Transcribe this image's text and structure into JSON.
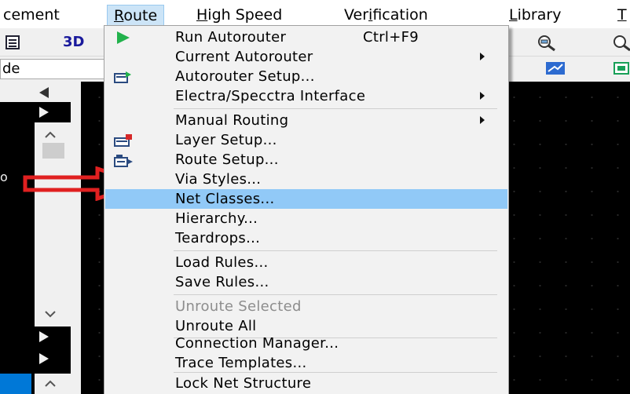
{
  "menubar": {
    "items": [
      {
        "label": "cement",
        "mnemonic": ""
      },
      {
        "label": "Route",
        "mnemonic": "R"
      },
      {
        "label": "High Speed",
        "mnemonic": "H"
      },
      {
        "label": "Verification",
        "mnemonic": "i"
      },
      {
        "label": "Library",
        "mnemonic": "L"
      },
      {
        "label": "T",
        "mnemonic": "T"
      }
    ]
  },
  "toolbar": {
    "view_3d_label": "3D",
    "mode_dropdown_value": "de"
  },
  "route_menu": {
    "items": [
      {
        "label": "Run Autorouter",
        "shortcut": "Ctrl+F9",
        "icon": "play-icon"
      },
      {
        "label": "Current Autorouter",
        "submenu": true
      },
      {
        "label": "Autorouter Setup...",
        "icon": "autorouter-setup-icon"
      },
      {
        "label": "Electra/Specctra Interface",
        "submenu": true
      },
      {
        "label": "Manual Routing",
        "submenu": true
      },
      {
        "label": "Layer Setup...",
        "icon": "layer-setup-icon"
      },
      {
        "label": "Route Setup...",
        "icon": "route-setup-icon"
      },
      {
        "label": "Via Styles..."
      },
      {
        "label": "Net Classes...",
        "highlighted": true
      },
      {
        "label": "Hierarchy..."
      },
      {
        "label": "Teardrops..."
      },
      {
        "label": "Load Rules..."
      },
      {
        "label": "Save Rules..."
      },
      {
        "label": "Unroute Selected",
        "disabled": true
      },
      {
        "label": "Unroute All"
      },
      {
        "label": "Connection Manager..."
      },
      {
        "label": "Trace Templates..."
      },
      {
        "label": "Lock Net Structure"
      }
    ]
  },
  "annotation": {
    "arrow_color": "#e02020",
    "points_to": "Net Classes..."
  },
  "left_panel": {
    "fragment_text": "o"
  },
  "colors": {
    "highlight": "#91c9f7",
    "menu_bg": "#f2f2f2",
    "canvas_bg": "#000000",
    "play_icon": "#22b24c",
    "disabled_text": "#8d8d8d"
  }
}
